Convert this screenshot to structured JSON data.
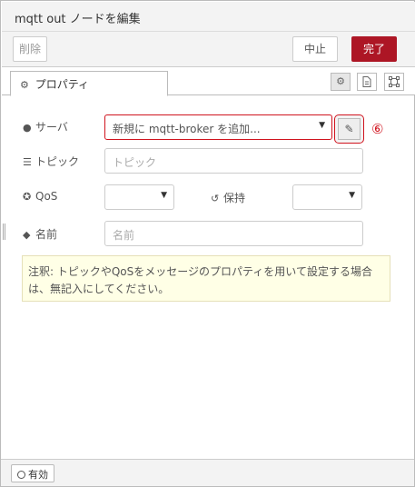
{
  "dialog": {
    "title": "mqtt out ノードを編集"
  },
  "toolbar": {
    "delete_label": "削除",
    "cancel_label": "中止",
    "done_label": "完了"
  },
  "tabs": {
    "properties_label": "プロパティ"
  },
  "form": {
    "server": {
      "label": "サーバ",
      "selected": "新規に mqtt-broker を追加..."
    },
    "topic": {
      "label": "トピック",
      "placeholder": "トピック",
      "value": ""
    },
    "qos": {
      "label": "QoS",
      "selected": ""
    },
    "retain": {
      "label": "保持",
      "selected": ""
    },
    "name": {
      "label": "名前",
      "placeholder": "名前",
      "value": ""
    }
  },
  "annotation": {
    "marker": "⑥"
  },
  "tip": {
    "text": "注釈: トピックやQoSをメッセージのプロパティを用いて設定する場合は、無記入にしてください。"
  },
  "footer": {
    "enabled_label": "有効"
  },
  "colors": {
    "accent": "#ad1625",
    "highlight": "#d0131e",
    "tip_bg": "#ffffe6"
  }
}
